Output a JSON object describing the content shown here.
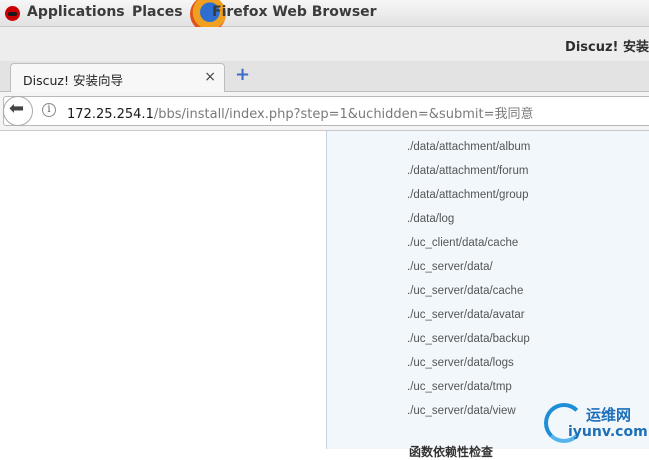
{
  "topbar": {
    "applications_label": "Applications",
    "places_label": "Places",
    "active_app_label": "Firefox Web Browser"
  },
  "window": {
    "title": "Discuz! 安装"
  },
  "tab": {
    "title": "Discuz! 安装向导",
    "close_glyph": "×",
    "new_tab_glyph": "+"
  },
  "urlbar": {
    "host": "172.25.254.1",
    "path": "/bbs/install/index.php?step=1&uchidden=&submit=我同意"
  },
  "content": {
    "directories": [
      "./data/attachment/album",
      "./data/attachment/forum",
      "./data/attachment/group",
      "./data/log",
      "./uc_client/data/cache",
      "./uc_server/data/",
      "./uc_server/data/cache",
      "./uc_server/data/avatar",
      "./uc_server/data/backup",
      "./uc_server/data/logs",
      "./uc_server/data/tmp",
      "./uc_server/data/view"
    ],
    "section_heading": "函数依赖性检查"
  },
  "watermark": {
    "text_cn": "运维网",
    "text_en": "iyunv.com"
  },
  "colors": {
    "panel_bg": "#f2f7fc",
    "panel_border": "#c5d3e3",
    "new_tab_accent": "#3c6ec8",
    "watermark": "#1d6fb8"
  }
}
